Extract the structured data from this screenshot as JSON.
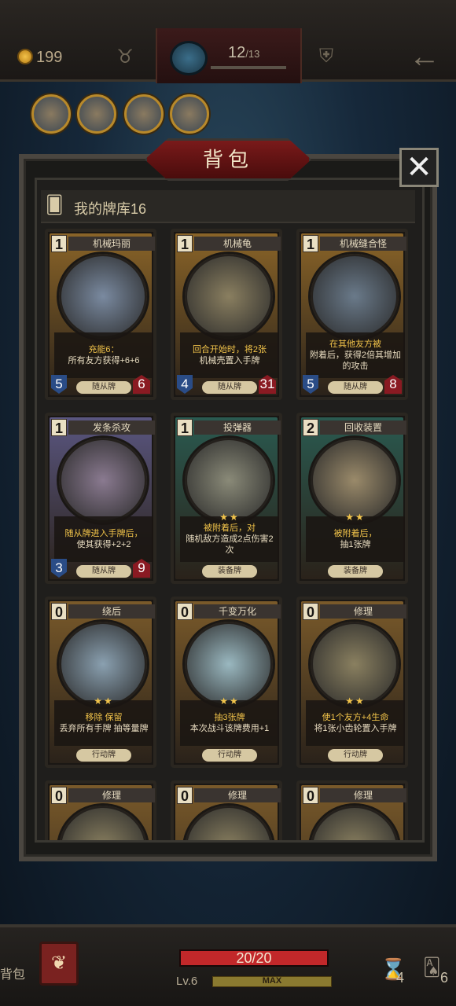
{
  "top": {
    "gold": "199",
    "stage_current": "12",
    "stage_total": "/13"
  },
  "relics": [
    {
      "icon": "relic-1-icon"
    },
    {
      "icon": "relic-2-icon"
    },
    {
      "icon": "relic-3-icon"
    },
    {
      "icon": "relic-4-icon"
    }
  ],
  "panel": {
    "title": "背包",
    "deck_label": "我的牌库16",
    "close": "✕"
  },
  "cards": [
    {
      "cost": "1",
      "name": "机械玛丽",
      "desc_a": "充能6：",
      "desc_b": "所有友方获得+6+6",
      "type": "随从牌",
      "atk": "5",
      "hp": "6",
      "frame": "#8a6428",
      "art": "#7a8aa0"
    },
    {
      "cost": "1",
      "name": "机械龟",
      "desc_a": "回合开始时，将2张",
      "desc_b": "机械壳置入手牌",
      "type": "随从牌",
      "atk": "4",
      "hp": "31",
      "frame": "#8a6428",
      "art": "#8a7f60"
    },
    {
      "cost": "1",
      "name": "机械缝合怪",
      "desc_a": "在其他友方被",
      "desc_b": "附着后，获得2倍其增加的攻击",
      "type": "随从牌",
      "atk": "5",
      "hp": "8",
      "frame": "#8a6428",
      "art": "#6a7a8a"
    },
    {
      "cost": "1",
      "name": "发条杀攻",
      "desc_a": "随从牌进入手牌后，",
      "desc_b": "使其获得+2+2",
      "type": "随从牌",
      "atk": "3",
      "hp": "9",
      "frame": "#5a5680",
      "art": "#8a7a90"
    },
    {
      "cost": "1",
      "name": "投弹器",
      "desc_a": "被附着后，对",
      "desc_b": "随机敌方造成2点伤害2次",
      "type": "装备牌",
      "atk": "",
      "hp": "",
      "frame": "#2a5a50",
      "art": "#8a8a78"
    },
    {
      "cost": "2",
      "name": "回收装置",
      "desc_a": "被附着后，",
      "desc_b": "抽1张牌",
      "type": "装备牌",
      "atk": "",
      "hp": "",
      "frame": "#2a5a50",
      "art": "#9a8a6a"
    },
    {
      "cost": "0",
      "name": "绕后",
      "desc_a": "移除 保留",
      "desc_b": "丢弃所有手牌 抽等量牌",
      "type": "行动牌",
      "atk": "",
      "hp": "",
      "frame": "#7a5a2a",
      "art": "#8aa0b0"
    },
    {
      "cost": "0",
      "name": "千变万化",
      "desc_a": "抽3张牌",
      "desc_b": "本次战斗该牌费用+1",
      "type": "行动牌",
      "atk": "",
      "hp": "",
      "frame": "#7a5a2a",
      "art": "#9ab8c0"
    },
    {
      "cost": "0",
      "name": "修理",
      "desc_a": "使1个友方+4生命",
      "desc_b": "将1张小齿轮置入手牌",
      "type": "行动牌",
      "atk": "",
      "hp": "",
      "frame": "#7a5a2a",
      "art": "#8a8060"
    },
    {
      "cost": "0",
      "name": "修理",
      "desc_a": "",
      "desc_b": "",
      "type": "",
      "atk": "",
      "hp": "",
      "frame": "#7a5a2a",
      "art": "#8a8060"
    },
    {
      "cost": "0",
      "name": "修理",
      "desc_a": "",
      "desc_b": "",
      "type": "",
      "atk": "",
      "hp": "",
      "frame": "#7a5a2a",
      "art": "#8a8060"
    },
    {
      "cost": "0",
      "name": "修理",
      "desc_a": "",
      "desc_b": "",
      "type": "",
      "atk": "",
      "hp": "",
      "frame": "#7a5a2a",
      "art": "#8a8060"
    }
  ],
  "bottom": {
    "bag_label": "背包",
    "hp": "20/20",
    "hp_fraction": 1.0,
    "level": "Lv.6",
    "xp_label": "MAX",
    "hourglass_count": "4",
    "deck_count": "6"
  }
}
